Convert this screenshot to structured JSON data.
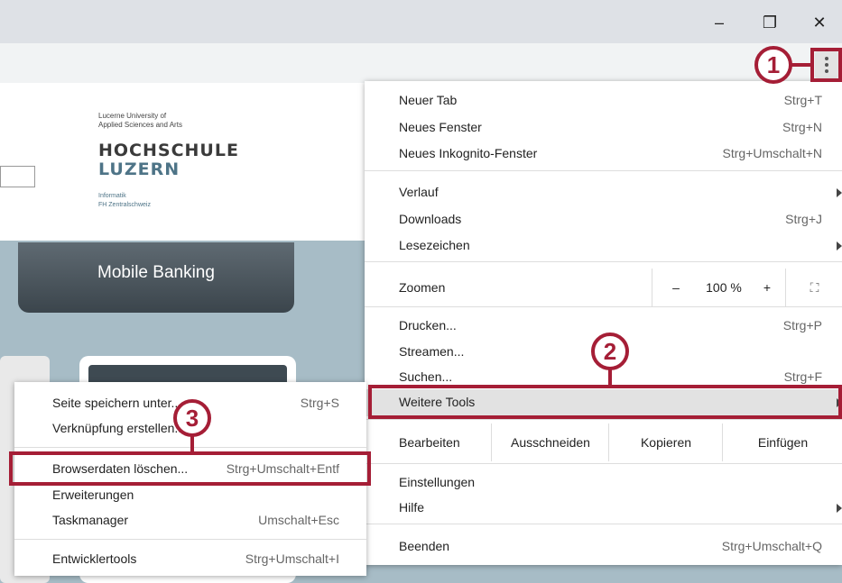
{
  "window": {
    "minimize": "–",
    "restore": "❐",
    "close": "✕"
  },
  "page": {
    "logo_line1": "Lucerne University of",
    "logo_line2": "Applied Sciences and Arts",
    "logo_hochschule": "HOCHSCHULE",
    "logo_luzern": "LUZERN",
    "logo_informatik": "Informatik",
    "logo_fh": "FH Zentralschweiz",
    "banking_label": "Mobile Banking"
  },
  "menu": {
    "new_tab": "Neuer Tab",
    "new_tab_sc": "Strg+T",
    "new_window": "Neues Fenster",
    "new_window_sc": "Strg+N",
    "incognito": "Neues Inkognito-Fenster",
    "incognito_sc": "Strg+Umschalt+N",
    "history": "Verlauf",
    "downloads": "Downloads",
    "downloads_sc": "Strg+J",
    "bookmarks": "Lesezeichen",
    "zoom": "Zoomen",
    "zoom_minus": "–",
    "zoom_value": "100 %",
    "zoom_plus": "+",
    "fullscreen": "⛶",
    "print": "Drucken...",
    "print_sc": "Strg+P",
    "cast": "Streamen...",
    "find": "Suchen...",
    "find_sc": "Strg+F",
    "more_tools": "Weitere Tools",
    "edit": "Bearbeiten",
    "cut": "Ausschneiden",
    "copy": "Kopieren",
    "paste": "Einfügen",
    "settings": "Einstellungen",
    "help": "Hilfe",
    "exit": "Beenden",
    "exit_sc": "Strg+Umschalt+Q"
  },
  "submenu": {
    "save_page": "Seite speichern unter...",
    "save_page_sc": "Strg+S",
    "create_shortcut": "Verknüpfung erstellen...",
    "clear_data": "Browserdaten löschen...",
    "clear_data_sc": "Strg+Umschalt+Entf",
    "extensions": "Erweiterungen",
    "task_manager": "Taskmanager",
    "task_manager_sc": "Umschalt+Esc",
    "dev_tools": "Entwicklertools",
    "dev_tools_sc": "Strg+Umschalt+I"
  },
  "callouts": {
    "one": "1",
    "two": "2",
    "three": "3"
  },
  "colors": {
    "accent": "#a51e36"
  }
}
